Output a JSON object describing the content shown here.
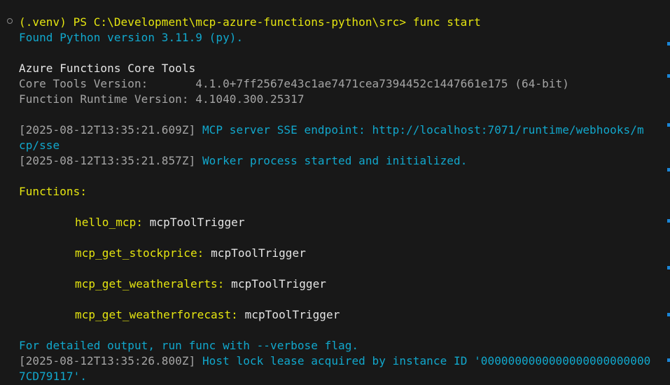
{
  "terminal": {
    "prompt": "(.venv) PS C:\\Development\\mcp-azure-functions-python\\src>",
    "command": "func start",
    "found_python": "Found Python version 3.11.9 (py).",
    "core_tools_title": "Azure Functions Core Tools",
    "core_tools_version": "Core Tools Version:       4.1.0+7ff2567e43c1ae7471cea7394452c1447661e175 (64-bit)",
    "runtime_version": "Function Runtime Version: 4.1040.300.25317",
    "log1_ts": "[2025-08-12T13:35:21.609Z]",
    "log1_msg_a": "MCP server SSE endpoint: http://localhost:7071/runtime/webhooks/m",
    "log1_msg_b": "cp/sse",
    "log2_ts": "[2025-08-12T13:35:21.857Z]",
    "log2_msg": "Worker process started and initialized.",
    "functions_header": "Functions:",
    "functions": [
      {
        "name": "hello_mcp:",
        "trigger": "mcpToolTrigger"
      },
      {
        "name": "mcp_get_stockprice:",
        "trigger": "mcpToolTrigger"
      },
      {
        "name": "mcp_get_weatheralerts:",
        "trigger": "mcpToolTrigger"
      },
      {
        "name": "mcp_get_weatherforecast:",
        "trigger": "mcpToolTrigger"
      }
    ],
    "verbose_hint": "For detailed output, run func with --verbose flag.",
    "log3_ts": "[2025-08-12T13:35:26.800Z]",
    "log3_msg_a": "Host lock lease acquired by instance ID '0000000000000000000000000",
    "log3_msg_b": "7CD79117'.",
    "colors": {
      "background": "#181818",
      "yellow": "#e5e510",
      "cyan": "#11a8cd",
      "gray": "#a5a5a5",
      "text": "#cccccc",
      "scrollbar_marker": "#1a85d6"
    }
  }
}
